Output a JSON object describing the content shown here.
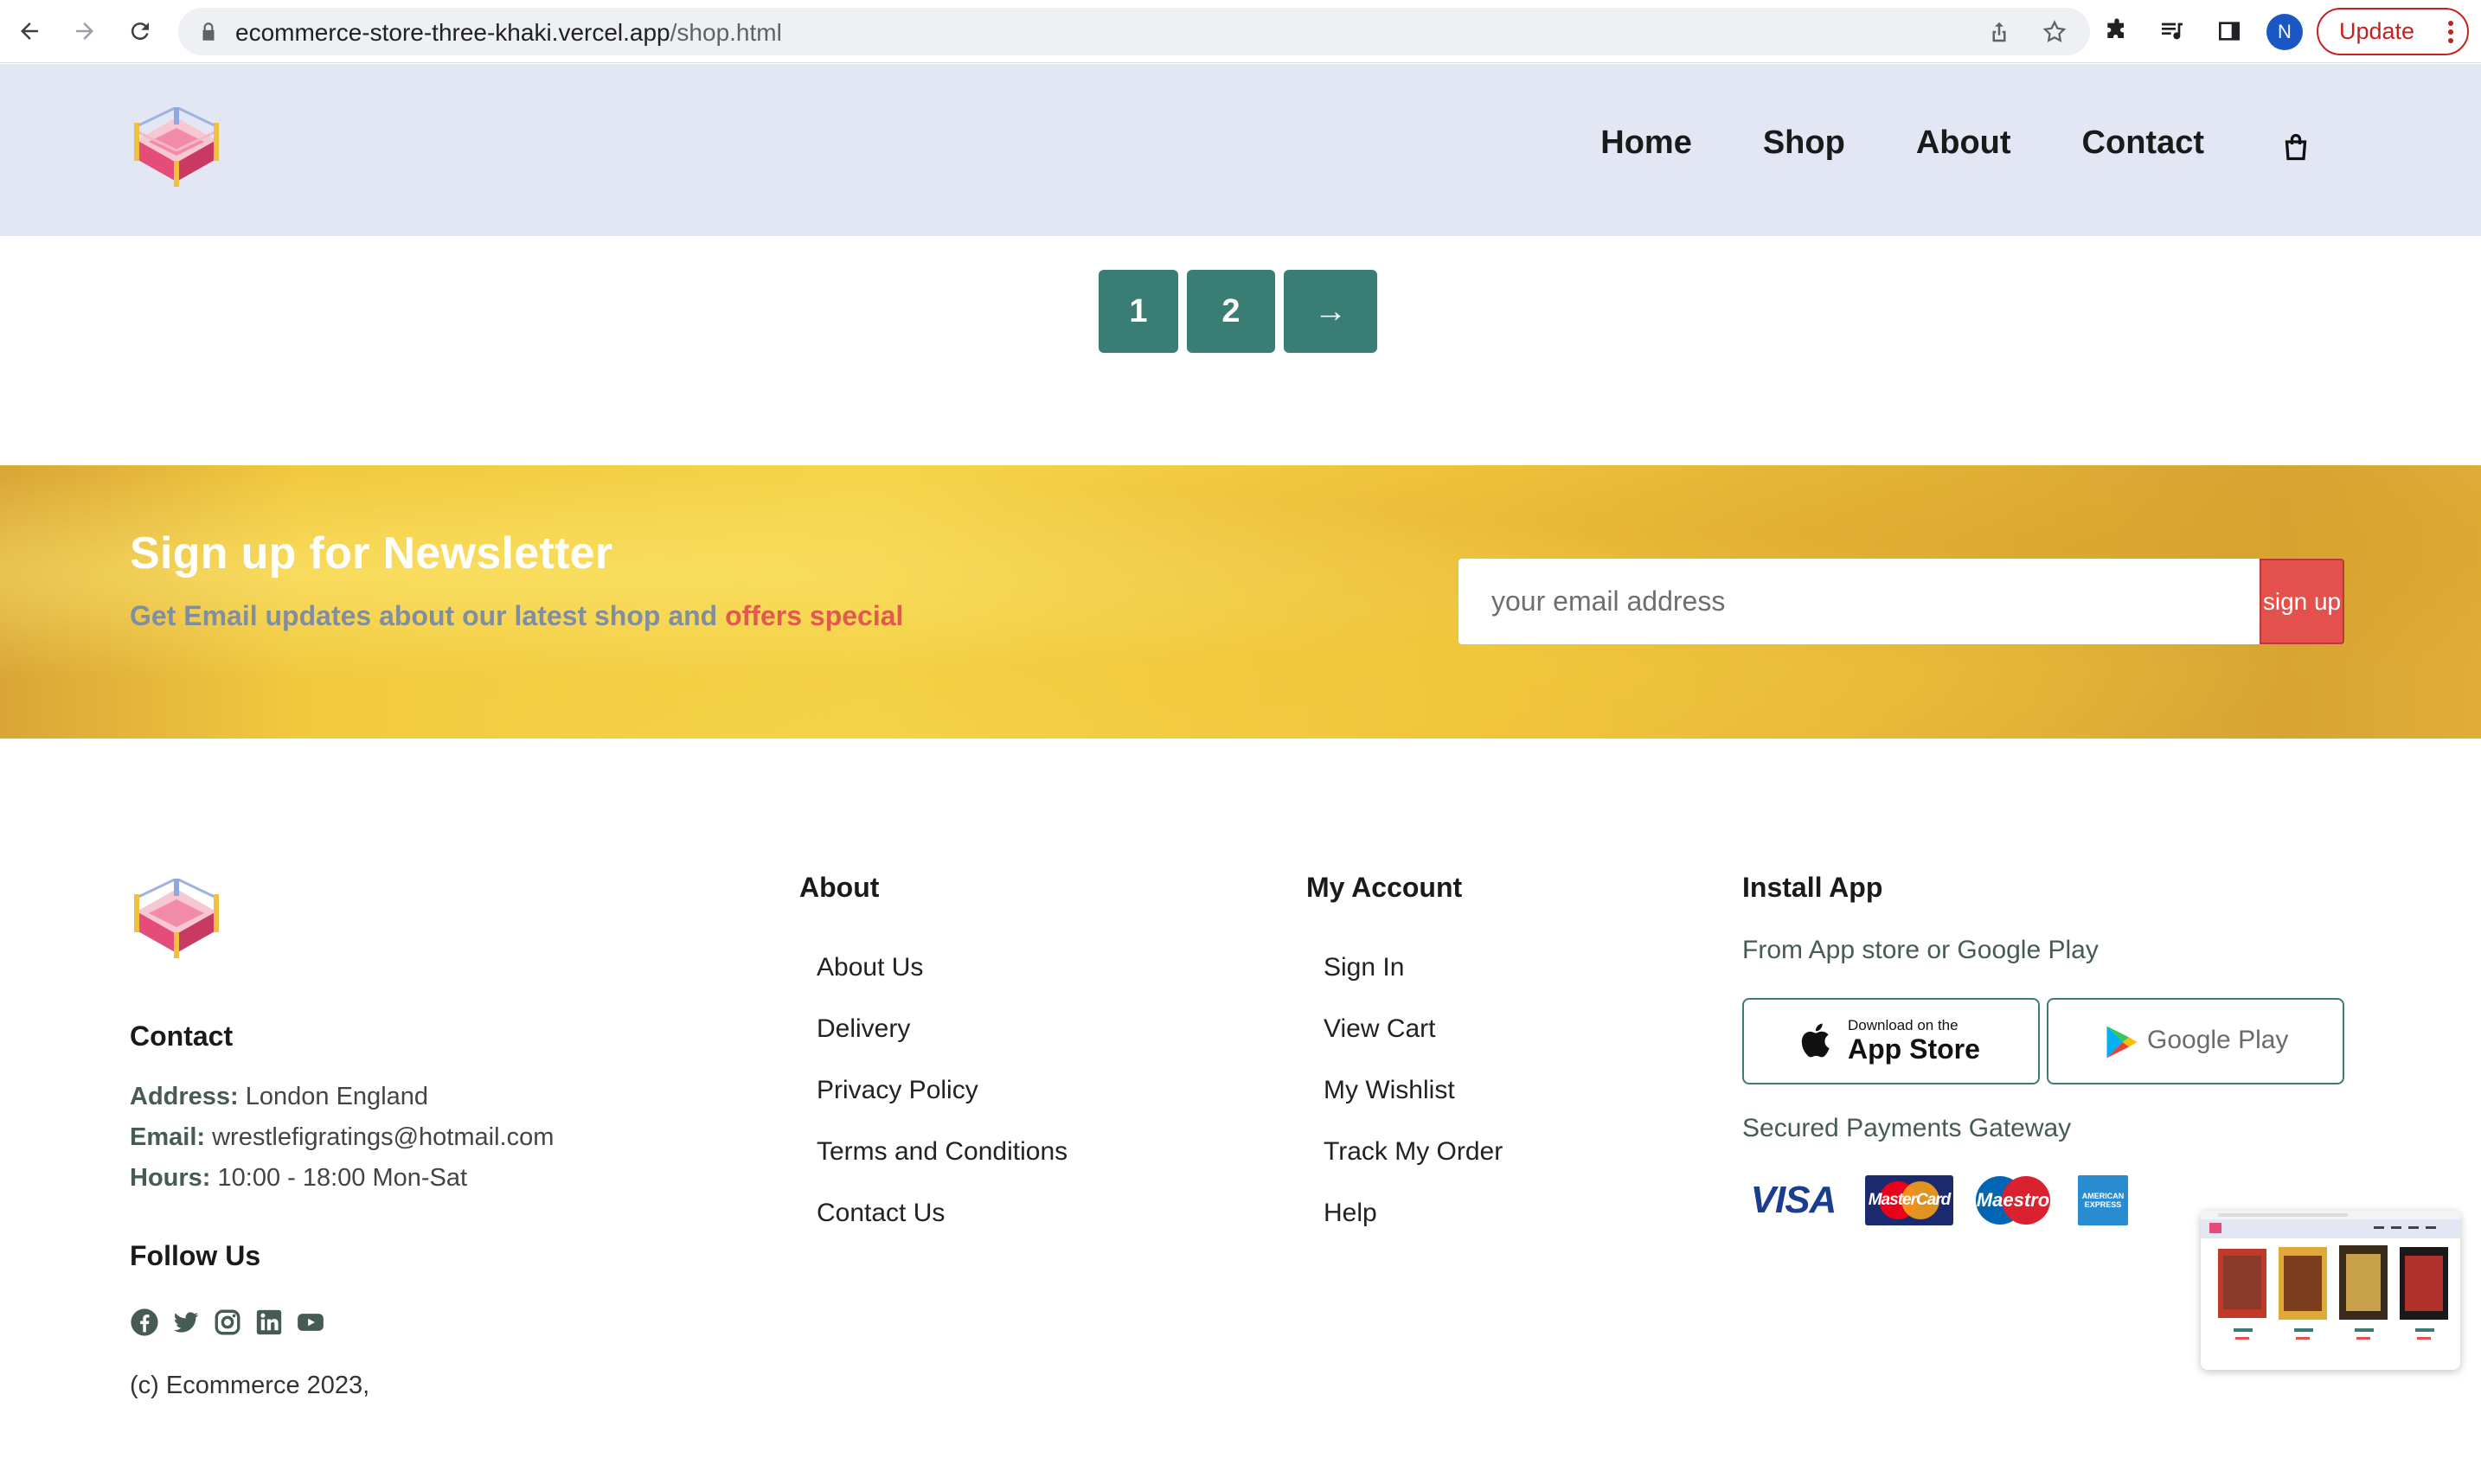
{
  "browser": {
    "url_host": "ecommerce-store-three-khaki.vercel.app",
    "url_path": "/shop.html",
    "profile_initial": "N",
    "update_label": "Update"
  },
  "header": {
    "nav": [
      "Home",
      "Shop",
      "About",
      "Contact"
    ]
  },
  "pagination": {
    "pages": [
      "1",
      "2"
    ],
    "next_symbol": "→"
  },
  "newsletter": {
    "title": "Sign up for Newsletter",
    "subtitle_part1": "Get Email updates about our latest shop and ",
    "subtitle_highlight": "offers special",
    "email_placeholder": "your email address",
    "signup_label": "sign up"
  },
  "footer": {
    "contact": {
      "heading": "Contact",
      "address_label": "Address:",
      "address_value": " London England",
      "email_label": "Email:",
      "email_value": " wrestlefigratings@hotmail.com",
      "hours_label": "Hours:",
      "hours_value": " 10:00 - 18:00 Mon-Sat",
      "follow_heading": "Follow Us",
      "socials": [
        "facebook-icon",
        "twitter-icon",
        "instagram-icon",
        "linkedin-icon",
        "youtube-icon"
      ],
      "copyright": "(c) Ecommerce 2023,"
    },
    "about": {
      "heading": "About",
      "links": [
        "About Us",
        "Delivery",
        "Privacy Policy",
        "Terms and Conditions",
        "Contact Us"
      ]
    },
    "account": {
      "heading": "My Account",
      "links": [
        "Sign In",
        "View Cart",
        "My Wishlist",
        "Track My Order",
        "Help"
      ]
    },
    "app": {
      "heading": "Install App",
      "subtitle": "From App store or Google Play",
      "appstore_small": "Download on the",
      "appstore_big": "App Store",
      "googleplay": "Google Play",
      "payments_heading": "Secured Payments Gateway",
      "payments": [
        "VISA",
        "MasterCard",
        "Maestro",
        "AMERICAN EXPRESS"
      ]
    }
  },
  "colors": {
    "header_bg": "#e3e6f3",
    "accent_teal": "#3a7d74",
    "signup_red": "#e4514c",
    "newsletter_gold": "#f2c83f"
  }
}
